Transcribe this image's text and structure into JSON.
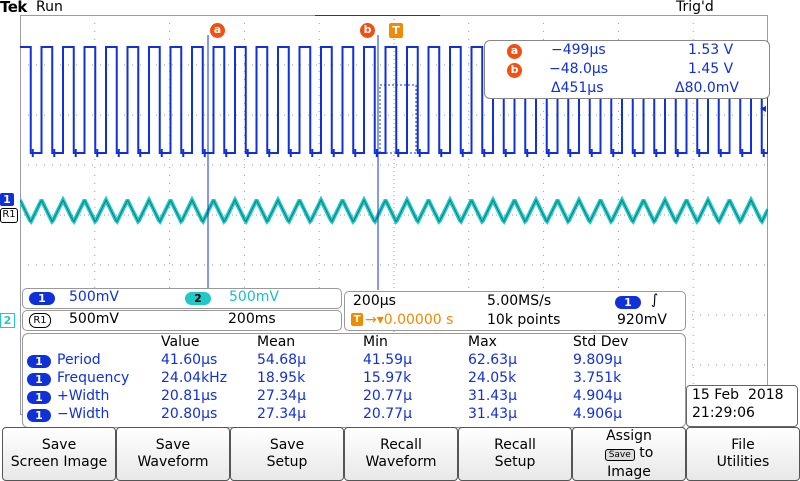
{
  "header": {
    "brand": "Tek",
    "run_state": "Run",
    "trigger_status": "Trig'd"
  },
  "markers": {
    "cursor_a": "a",
    "cursor_b": "b",
    "trigger": "T",
    "ch1": "1",
    "ref1": "R1",
    "ch2": "2"
  },
  "cursor_readout": {
    "a_time": "−499µs",
    "a_volt": "1.53 V",
    "b_time": "−48.0µs",
    "b_volt": "1.45 V",
    "delta_time": "Δ451µs",
    "delta_volt": "Δ80.0mV"
  },
  "channels": {
    "ch1_label": "1",
    "ch1_scale": "500mV",
    "ch2_label": "2",
    "ch2_scale": "500mV",
    "ref1_label": "R1",
    "ref1_scale": "500mV",
    "ref1_time": "200ms"
  },
  "timebase": {
    "time_div": "200µs",
    "sample_rate": "5.00MS/s",
    "trigger_position": "→▾0.00000 s",
    "record_length": "10k points",
    "trigger_channel": "1",
    "trigger_slope": "∫",
    "trigger_level": "920mV"
  },
  "measurements": {
    "headers": [
      "Value",
      "Mean",
      "Min",
      "Max",
      "Std Dev"
    ],
    "rows": [
      {
        "ch": "1",
        "name": "Period",
        "value": "41.60µs",
        "mean": "54.68µ",
        "min": "41.59µ",
        "max": "62.63µ",
        "std": "9.809µ"
      },
      {
        "ch": "1",
        "name": "Frequency",
        "value": "24.04kHz",
        "mean": "18.95k",
        "min": "15.97k",
        "max": "24.05k",
        "std": "3.751k"
      },
      {
        "ch": "1",
        "name": "+Width",
        "value": "20.81µs",
        "mean": "27.34µ",
        "min": "20.77µ",
        "max": "31.43µ",
        "std": "4.904µ"
      },
      {
        "ch": "1",
        "name": "−Width",
        "value": "20.80µs",
        "mean": "27.34µ",
        "min": "20.77µ",
        "max": "31.43µ",
        "std": "4.906µ"
      }
    ]
  },
  "datetime": {
    "date": "15 Feb  2018",
    "time": "21:29:06"
  },
  "softkeys": [
    {
      "line1": "Save",
      "line2": "Screen Image"
    },
    {
      "line1": "Save",
      "line2": "Waveform"
    },
    {
      "line1": "Save",
      "line2": "Setup"
    },
    {
      "line1": "Recall",
      "line2": "Waveform"
    },
    {
      "line1": "Recall",
      "line2": "Setup"
    },
    {
      "line1": "Assign",
      "line2a": "Save",
      "line2b": "to",
      "line3": "Image"
    },
    {
      "line1": "File",
      "line2": "Utilities"
    }
  ],
  "colors": {
    "ch1": "#1030d8",
    "ch2": "#22c8c8",
    "cursor": "#f05010",
    "trigger": "#f08a00"
  }
}
